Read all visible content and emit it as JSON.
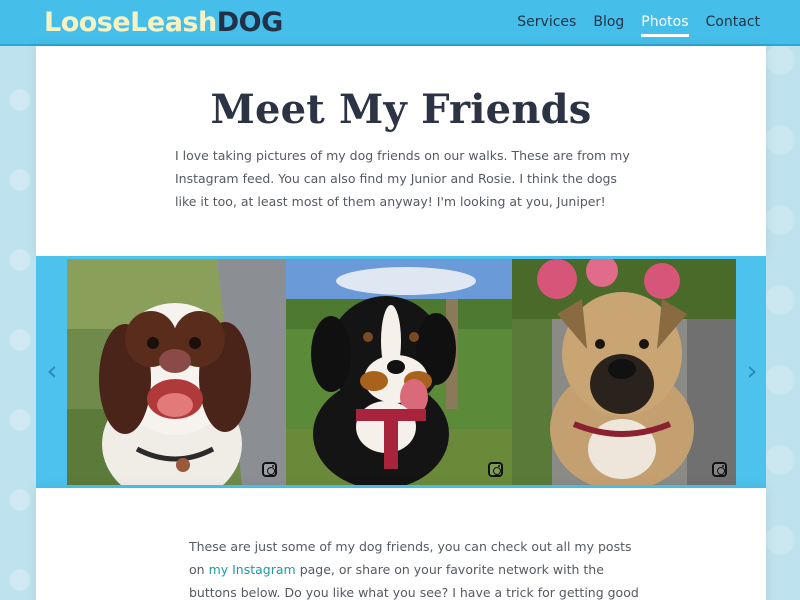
{
  "header": {
    "logo_part1": "LooseLeash",
    "logo_part2": "DOG",
    "nav": [
      {
        "label": "Services"
      },
      {
        "label": "Blog"
      },
      {
        "label": "Photos",
        "active": true
      },
      {
        "label": "Contact"
      }
    ]
  },
  "hero": {
    "title": "Meet My Friends",
    "intro": "I love taking pictures of my dog friends on our walks. These are from my Instagram feed. You can also find my Junior and Rosie. I think the dogs like it too, at least most of them anyway! I'm looking at you, Juniper!"
  },
  "gallery": {
    "prev_icon": "chevron-left-icon",
    "next_icon": "chevron-right-icon",
    "prev_glyph": "‹",
    "next_glyph": "›",
    "photos": [
      {
        "name": "springer-spaniel-photo",
        "icon": "instagram-icon"
      },
      {
        "name": "bernese-mountain-dog-photo",
        "icon": "instagram-icon"
      },
      {
        "name": "tan-mastiff-photo",
        "icon": "instagram-icon"
      }
    ]
  },
  "outro": {
    "text_before": "These are just some of my dog friends, you can check out all my posts on",
    "link": "my Instagram",
    "text_after": "page, or share on your favorite network with the buttons below. Do you like what you see? I have a trick for getting good pictures."
  },
  "colors": {
    "header_bg": "#45bfe9",
    "logo_light": "#f6f2c4",
    "logo_dark": "#223147",
    "strip_bg": "#4cc2ec",
    "link": "#1c9c9c"
  }
}
